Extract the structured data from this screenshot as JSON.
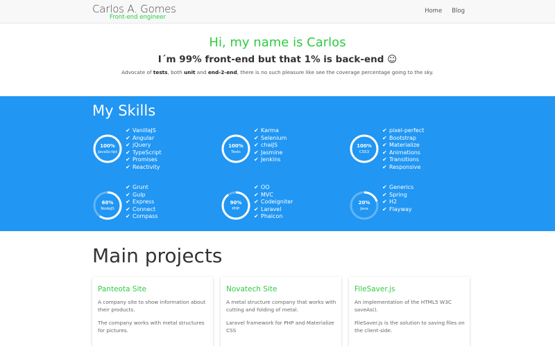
{
  "header": {
    "brand": "Carlos A. Gomes",
    "tagline": "Front-end engineer",
    "nav": [
      "Home",
      "Blog"
    ]
  },
  "hero": {
    "title": "Hi, my name is Carlos",
    "subtitle": "I´m 99% front-end but that 1% is back-end ☺",
    "desc_parts": [
      "Advocate of ",
      "tests",
      ", both ",
      "unit",
      " and ",
      "end-2-end",
      ", there is no such pleasure like see the coverage percentage going to the sky."
    ]
  },
  "skills": {
    "title": "My Skills",
    "accent": "#2196f3",
    "groups": [
      {
        "percent": "100%",
        "value": 1.0,
        "name": "JavaScript",
        "items": [
          "VanillaJS",
          "Angular",
          "jQuery",
          "TypeScript",
          "Promises",
          "Reactivity"
        ]
      },
      {
        "percent": "100%",
        "value": 1.0,
        "name": "Tests",
        "items": [
          "Karma",
          "Selenium",
          "chaiJS",
          "Jasmine",
          "Jenkins"
        ]
      },
      {
        "percent": "100%",
        "value": 1.0,
        "name": "CSS3",
        "items": [
          "pixel-perfect",
          "Bootstrap",
          "Materialize",
          "Animations",
          "Transitions",
          "Responsive"
        ]
      },
      {
        "percent": "60%",
        "value": 0.6,
        "name": "NodeJS",
        "items": [
          "Grunt",
          "Gulp",
          "Express",
          "Connect",
          "Compass"
        ]
      },
      {
        "percent": "90%",
        "value": 0.9,
        "name": "PHP",
        "items": [
          "OO",
          "MVC",
          "Codeigniter",
          "Laravel",
          "Phalcon"
        ]
      },
      {
        "percent": "20%",
        "value": 0.2,
        "name": "Java",
        "items": [
          "Generics",
          "Spring",
          "H2",
          "Flayway"
        ]
      }
    ]
  },
  "projects": {
    "title": "Main projects",
    "cards": [
      {
        "title": "Panteota Site",
        "p1": "A company site to show information about their products.",
        "p2": "The company works with metal structures for pictures."
      },
      {
        "title": "Novatech Site",
        "p1": "A metal structure company that works with cutting and folding of metal.",
        "p2": "Laravel framework for PHP and Materialize CSS"
      },
      {
        "title": "FileSaver.js",
        "p1": "An implementation of the HTML5 W3C saveAs().",
        "p2": "FileSaver.js is the solution to saving files on the client-side."
      }
    ]
  }
}
